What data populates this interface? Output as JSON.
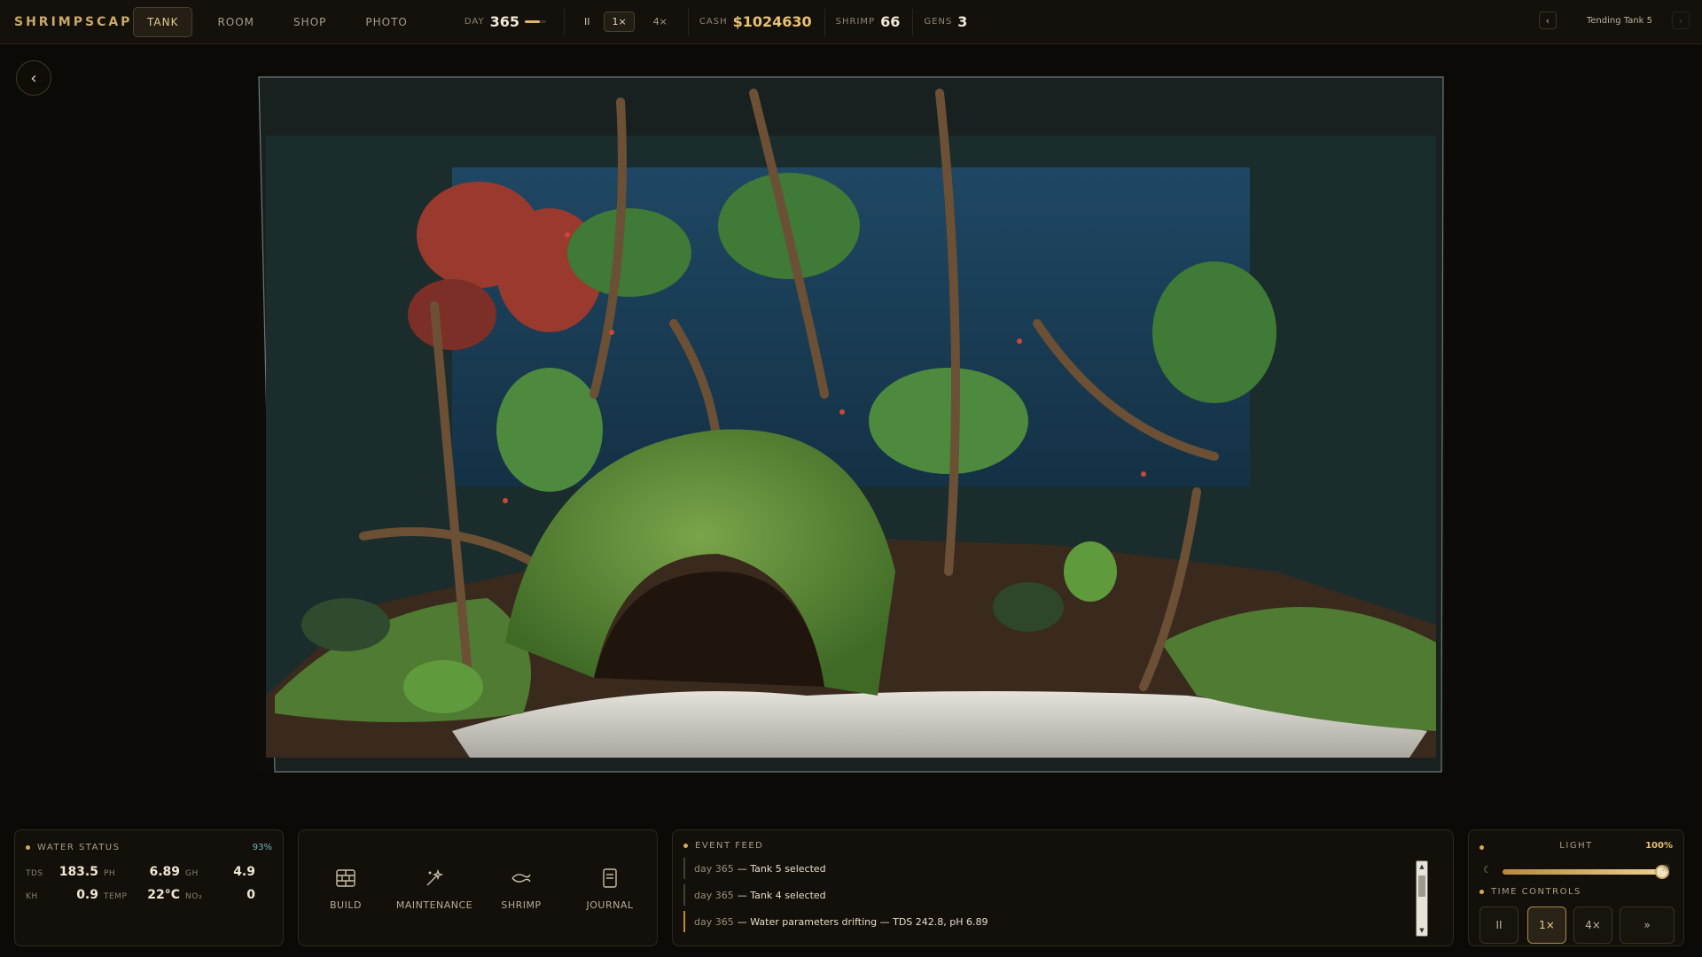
{
  "app": {
    "brand": "SHRIMPSCAPE",
    "tabs": [
      "TANK",
      "ROOM",
      "SHOP",
      "PHOTO"
    ],
    "active_tab": "TANK"
  },
  "header": {
    "day_label": "DAY",
    "day_value": "365",
    "day_progress": 0.7,
    "pause_symbol": "II",
    "speed_1": "1×",
    "speed_4": "4×",
    "cash_label": "CASH",
    "cash_value": "$1024630",
    "shrimp_label": "SHRIMP",
    "shrimp_value": "66",
    "gens_label": "GENS",
    "gens_value": "3",
    "nav_prev": "‹",
    "nav_next": "›",
    "tending": "Tending Tank 5"
  },
  "back_symbol": "‹",
  "water": {
    "title": "WATER STATUS",
    "percent": "93%",
    "tds_label": "TDS",
    "tds": "183.5",
    "ph_label": "PH",
    "ph": "6.89",
    "gh_label": "GH",
    "gh": "4.9",
    "kh_label": "KH",
    "kh": "0.9",
    "temp_label": "TEMP",
    "temp": "22°C",
    "no3_label": "NO₃",
    "no3": "0"
  },
  "actions": {
    "build": "BUILD",
    "maintenance": "MAINTENANCE",
    "shrimp": "SHRIMP",
    "journal": "JOURNAL"
  },
  "feed": {
    "title": "EVENT FEED",
    "items": [
      {
        "day": "day 365",
        "text": "— Tank 5 selected"
      },
      {
        "day": "day 365",
        "text": "— Tank 4 selected"
      },
      {
        "day": "day 365",
        "text": "— Water parameters drifting — TDS 242.8, pH 6.89"
      }
    ]
  },
  "light": {
    "title": "LIGHT",
    "percent": "100%",
    "level": 1.0,
    "time_title": "TIME CONTROLS",
    "pause": "II",
    "speed_1": "1×",
    "speed_4": "4×",
    "skip": "»"
  },
  "colors": {
    "accent": "#e7c172",
    "background": "#0c0a07",
    "panel": "#13100b",
    "water": "#1d3b52",
    "sand": "#dcdad0",
    "moss": "#5f8a3b"
  }
}
